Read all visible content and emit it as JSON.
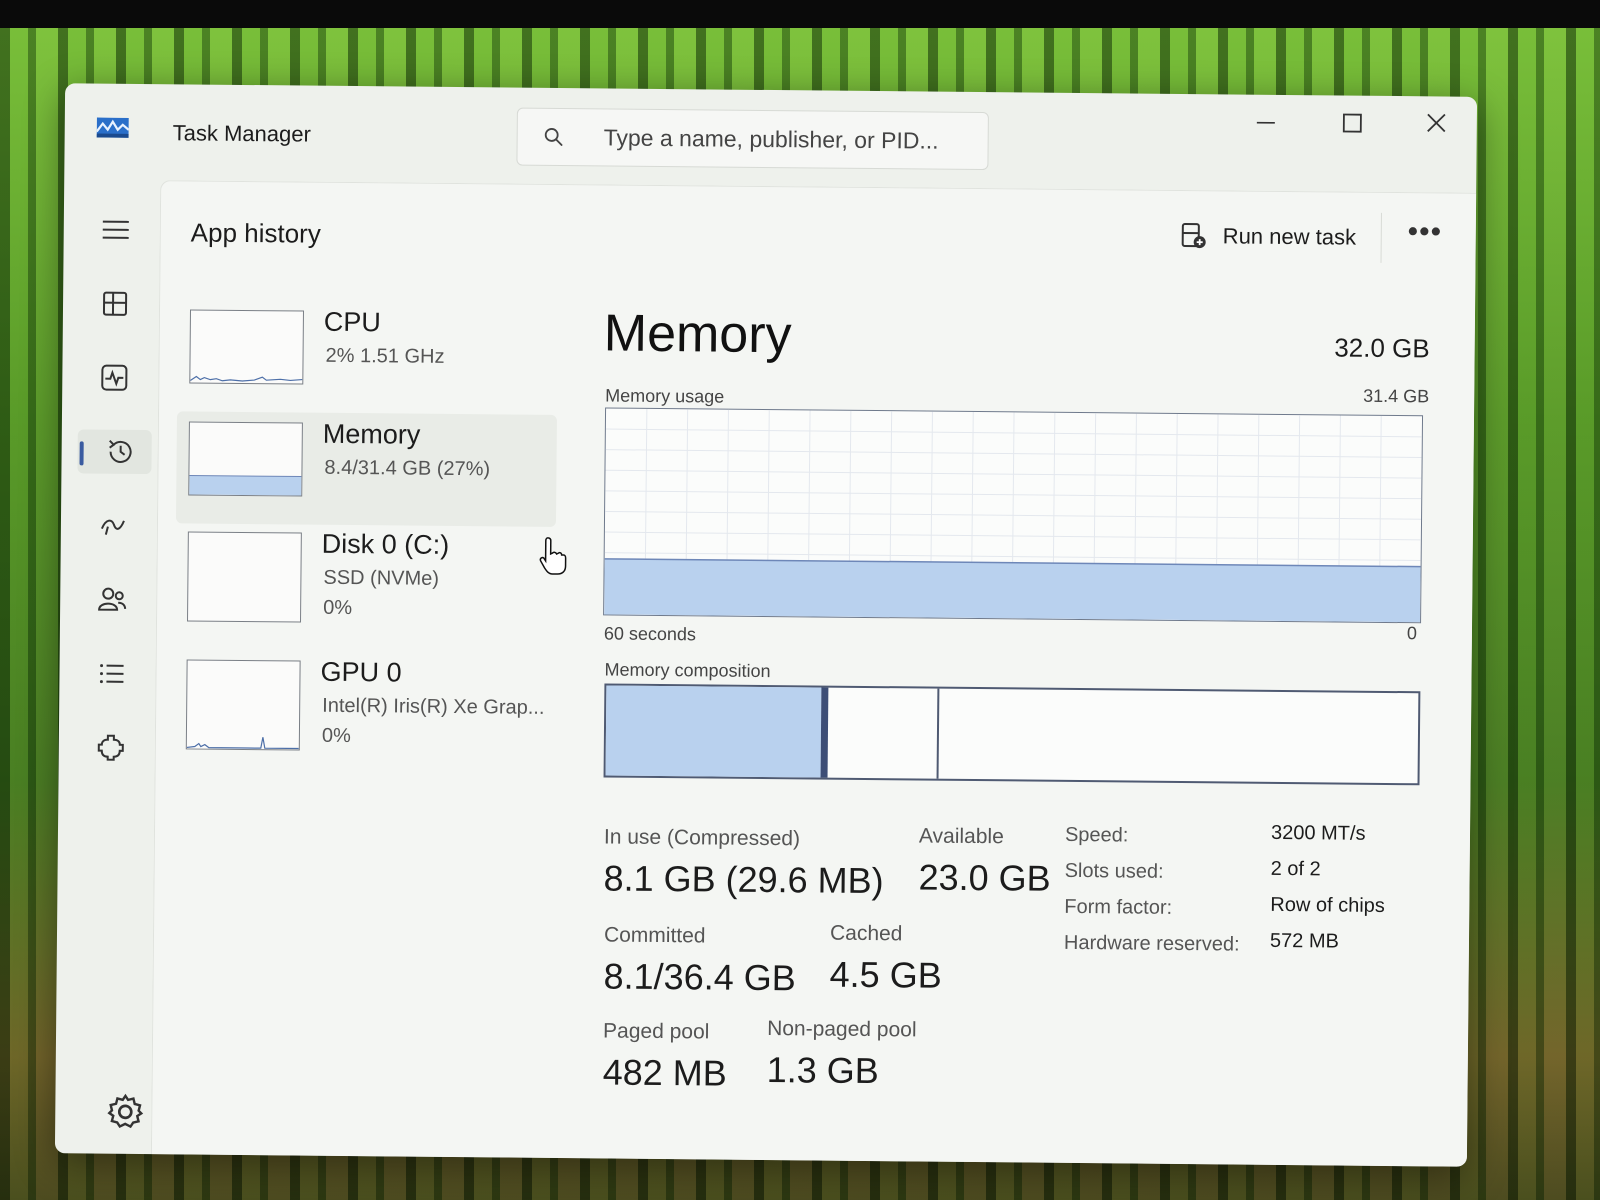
{
  "window": {
    "title": "Task Manager",
    "search_placeholder": "Type a name, publisher, or PID..."
  },
  "nav": {
    "items": [
      {
        "icon": "hamburger-menu-icon"
      },
      {
        "icon": "processes-icon"
      },
      {
        "icon": "performance-icon"
      },
      {
        "icon": "app-history-icon",
        "active": true
      },
      {
        "icon": "startup-apps-icon"
      },
      {
        "icon": "users-icon"
      },
      {
        "icon": "details-icon"
      },
      {
        "icon": "services-icon"
      }
    ],
    "settings_icon": "gear-icon"
  },
  "header": {
    "page_title": "App history",
    "run_new_task": "Run new task",
    "more": "•••"
  },
  "resources": [
    {
      "name": "CPU",
      "line1": "2%  1.51 GHz",
      "line2": ""
    },
    {
      "name": "Memory",
      "line1": "8.4/31.4 GB (27%)",
      "line2": "",
      "selected": true
    },
    {
      "name": "Disk 0 (C:)",
      "line1": "SSD (NVMe)",
      "line2": "0%"
    },
    {
      "name": "GPU 0",
      "line1": "Intel(R) Iris(R) Xe Grap...",
      "line2": "0%"
    }
  ],
  "detail": {
    "title": "Memory",
    "total": "32.0 GB",
    "usage_label": "Memory usage",
    "usage_max": "31.4 GB",
    "usage_fraction": 0.27,
    "axis_left": "60 seconds",
    "axis_right": "0",
    "composition_label": "Memory composition",
    "composition": {
      "in_use_fraction": 0.265,
      "modified_fraction": 0.008,
      "standby_end_fraction": 0.408
    },
    "stats": {
      "in_use_label": "In use (Compressed)",
      "in_use_value": "8.1 GB (29.6 MB)",
      "available_label": "Available",
      "available_value": "23.0 GB",
      "committed_label": "Committed",
      "committed_value": "8.1/36.4 GB",
      "cached_label": "Cached",
      "cached_value": "4.5 GB",
      "paged_label": "Paged pool",
      "paged_value": "482 MB",
      "nonpaged_label": "Non-paged pool",
      "nonpaged_value": "1.3 GB"
    },
    "properties": [
      {
        "key": "Speed:",
        "value": "3200 MT/s"
      },
      {
        "key": "Slots used:",
        "value": "2 of 2"
      },
      {
        "key": "Form factor:",
        "value": "Row of chips"
      },
      {
        "key": "Hardware reserved:",
        "value": "572 MB"
      }
    ]
  },
  "colors": {
    "memory_fill": "#b9d1ee",
    "memory_line": "#6e87b8",
    "accent": "#3a5ba0"
  }
}
